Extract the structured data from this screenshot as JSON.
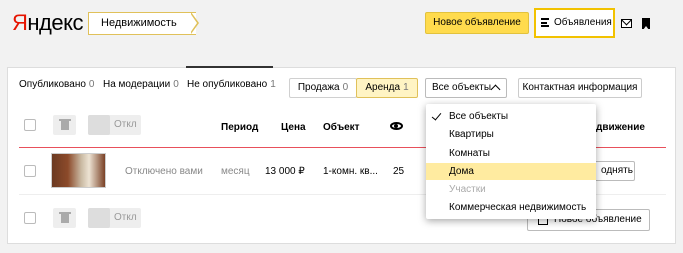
{
  "header": {
    "logo": {
      "first_letter": "Я",
      "rest": "ндекс"
    },
    "section": "Недвижимость",
    "new_ad_button": "Новое объявление",
    "ads_link": "Объявления"
  },
  "tabs": [
    {
      "label": "Опубликовано",
      "count": "0"
    },
    {
      "label": "На модерации",
      "count": "0"
    },
    {
      "label": "Не опубликовано",
      "count": "1"
    }
  ],
  "deal_type": [
    {
      "label": "Продажа",
      "count": "0"
    },
    {
      "label": "Аренда",
      "count": "1"
    }
  ],
  "object_filter": {
    "selected": "Все объекты",
    "options": [
      {
        "label": "Все объекты",
        "checked": true
      },
      {
        "label": "Квартиры"
      },
      {
        "label": "Комнаты"
      },
      {
        "label": "Дома",
        "highlighted": true
      },
      {
        "label": "Участки",
        "disabled": true
      },
      {
        "label": "Коммерческая недвижимость"
      }
    ]
  },
  "contact_button": "Контактная информация",
  "table": {
    "off_label": "Откл",
    "headers": {
      "period": "Период",
      "price": "Цена",
      "object": "Объект",
      "promotion": "движение"
    },
    "rows": [
      {
        "status": "Отключено вами",
        "period": "месяц",
        "price": "13 000 ₽",
        "object": "1-комн. кв...",
        "views": "25",
        "raise_button": "однять"
      }
    ]
  },
  "footer": {
    "new_ad_button": "Новое объявление"
  },
  "colors": {
    "accent": "#ffdb4d",
    "logo_red": "#e61400",
    "separator": "#e8505b",
    "highlight": "#ffeba0"
  }
}
